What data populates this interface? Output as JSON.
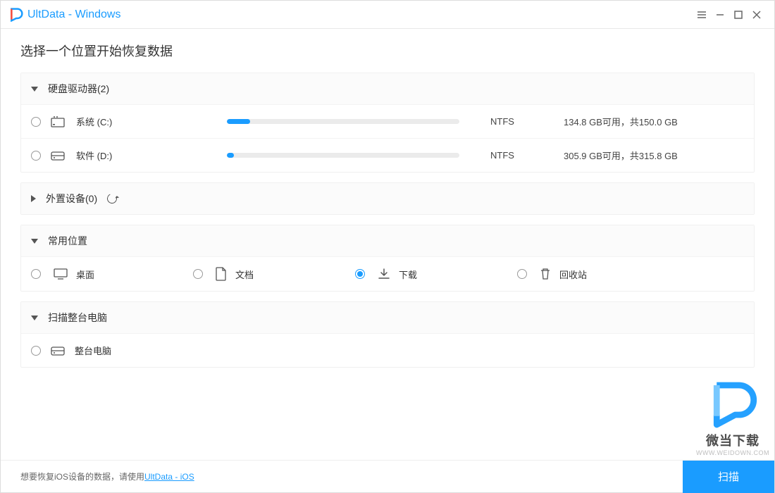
{
  "titlebar": {
    "title": "UltData - Windows"
  },
  "page_title": "选择一个位置开始恢复数据",
  "sections": {
    "drives": {
      "title": "硬盘驱动器(2)",
      "expanded": true,
      "items": [
        {
          "name": "系统 (C:)",
          "fs": "NTFS",
          "size_text": "134.8 GB可用，共150.0 GB",
          "used_percent": 10
        },
        {
          "name": "软件 (D:)",
          "fs": "NTFS",
          "size_text": "305.9 GB可用，共315.8 GB",
          "used_percent": 3
        }
      ]
    },
    "external": {
      "title": "外置设备(0)",
      "expanded": false
    },
    "common": {
      "title": "常用位置",
      "expanded": true,
      "items": [
        {
          "label": "桌面",
          "selected": false
        },
        {
          "label": "文档",
          "selected": false
        },
        {
          "label": "下载",
          "selected": true
        },
        {
          "label": "回收站",
          "selected": false
        }
      ]
    },
    "whole_pc": {
      "title": "扫描整台电脑",
      "expanded": true,
      "item_label": "整台电脑"
    }
  },
  "footer": {
    "hint_prefix": "想要恢复iOS设备的数据，请使用",
    "hint_link": "UltData - iOS",
    "scan_button": "扫描"
  },
  "watermark": {
    "text": "微当下载",
    "url": "WWW.WEIDOWN.COM"
  }
}
